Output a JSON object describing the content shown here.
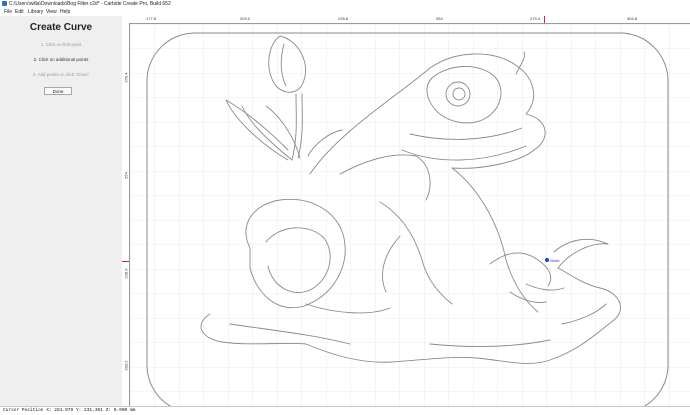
{
  "window": {
    "title": "C:\\Users\\willa\\Downloads\\Bog Filter.c2d* - Carbide Create Pro, Build 652"
  },
  "menu": [
    "File",
    "Edit",
    "Library",
    "View",
    "Help"
  ],
  "panel": {
    "title": "Create Curve",
    "steps": [
      "1. Click on first point",
      "2. Click on additional points",
      "3. Add points or click \"Done\""
    ],
    "done_label": "Done"
  },
  "ruler": {
    "top_labels": [
      "177.8",
      "203.2",
      "228.6",
      "254",
      "279.4",
      "304.8"
    ],
    "left_labels": [
      "279.4",
      "254",
      "228.6",
      "203.2"
    ]
  },
  "canvas": {
    "node_label": "Node"
  },
  "status": {
    "cursor_text": "Cursor Position X: 281.079 Y: 231.361 Z: 0.000 mm"
  },
  "colors": {
    "grid": "#dcdcdc",
    "outline": "#8a8a8a",
    "marker": "#e0202e",
    "node": "#1a3fc8"
  }
}
